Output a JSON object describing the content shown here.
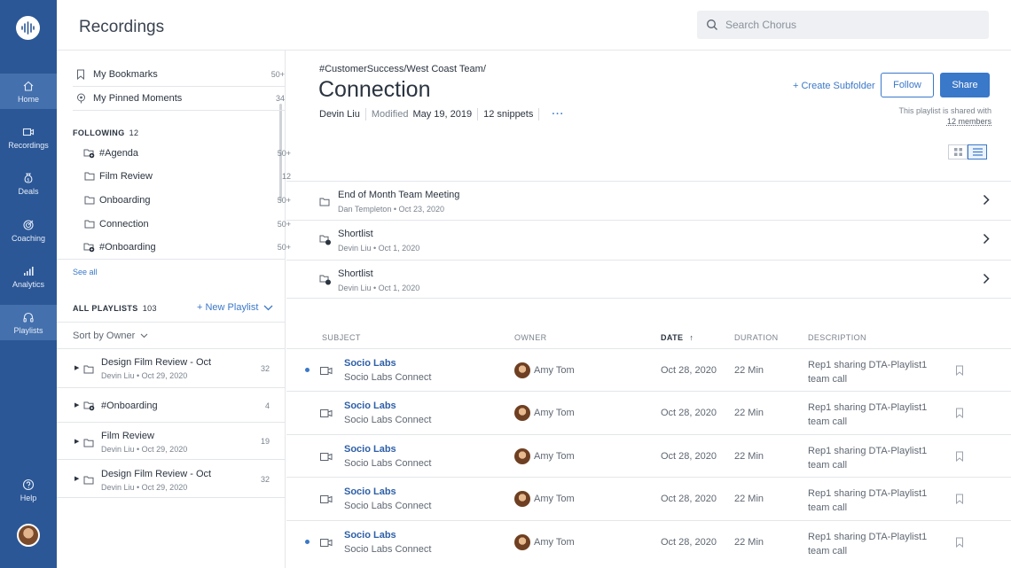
{
  "app": {
    "nav": [
      {
        "label": "Home",
        "icon": "home-icon",
        "active": true
      },
      {
        "label": "Recordings",
        "icon": "video-icon",
        "active": false
      },
      {
        "label": "Deals",
        "icon": "money-bag-icon",
        "active": false
      },
      {
        "label": "Coaching",
        "icon": "target-icon",
        "active": false
      },
      {
        "label": "Analytics",
        "icon": "bar-chart-icon",
        "active": false
      },
      {
        "label": "Playlists",
        "icon": "headphones-icon",
        "active": true
      },
      {
        "label": "Help",
        "icon": "help-icon",
        "active": false
      }
    ],
    "brand_color": "#2b5796",
    "accent_color": "#3a78c9"
  },
  "header": {
    "title": "Recordings",
    "search_placeholder": "Search Chorus"
  },
  "sidebar": {
    "top_items": [
      {
        "label": "My Bookmarks",
        "count": "50+",
        "icon": "bookmark-icon"
      },
      {
        "label": "My Pinned Moments",
        "count": "34",
        "icon": "pin-icon"
      }
    ],
    "following": {
      "heading": "FOLLOWING",
      "count": "12",
      "items": [
        {
          "label": "#Agenda",
          "count": "50+",
          "icon": "shared-folder-icon"
        },
        {
          "label": "Film Review",
          "count": "12",
          "icon": "folder-icon"
        },
        {
          "label": "Onboarding",
          "count": "50+",
          "icon": "folder-icon"
        },
        {
          "label": "Connection",
          "count": "50+",
          "icon": "folder-icon"
        },
        {
          "label": "#Onboarding",
          "count": "50+",
          "icon": "shared-folder-icon"
        }
      ],
      "see_all": "See all"
    },
    "all_playlists": {
      "heading": "ALL PLAYLISTS",
      "count": "103",
      "new_playlist": "+ New Playlist",
      "sort_label": "Sort by Owner",
      "items": [
        {
          "title": "Design Film Review - Oct",
          "sub": "Devin Liu • Oct 29, 2020",
          "count": "32",
          "icon": "folder-icon"
        },
        {
          "title": "#Onboarding",
          "sub": "",
          "count": "4",
          "icon": "shared-folder-icon"
        },
        {
          "title": "Film Review",
          "sub": "Devin Liu • Oct 29, 2020",
          "count": "19",
          "icon": "folder-icon"
        },
        {
          "title": "Design Film Review - Oct",
          "sub": "Devin Liu • Oct 29, 2020",
          "count": "32",
          "icon": "folder-icon"
        }
      ]
    }
  },
  "playlist": {
    "breadcrumb": "#CustomerSuccess/West Coast Team/",
    "title": "Connection",
    "owner": "Devin Liu",
    "modified_label": "Modified",
    "modified_date": "May 19, 2019",
    "snippets": "12 snippets",
    "more": "···",
    "create_subfolder": "+ Create Subfolder",
    "follow_label": "Follow",
    "share_label": "Share",
    "shared_text": "This playlist is shared with",
    "shared_members": "12 members",
    "subfolders": [
      {
        "title": "End of Month Team Meeting",
        "sub": "Dan Templeton • Oct 23, 2020",
        "icon": "folder-icon"
      },
      {
        "title": "Shortlist",
        "sub": "Devin Liu • Oct 1, 2020",
        "icon": "private-folder-icon"
      },
      {
        "title": "Shortlist",
        "sub": "Devin Liu • Oct 1, 2020",
        "icon": "private-folder-icon"
      }
    ],
    "table": {
      "headers": {
        "subject": "SUBJECT",
        "owner": "OWNER",
        "date": "DATE",
        "duration": "DURATION",
        "description": "DESCRIPTION"
      },
      "sort_arrow": "↑",
      "rows": [
        {
          "unread": true,
          "subject": "Socio Labs",
          "subtitle": "Socio Labs Connect",
          "owner": "Amy Tom",
          "date": "Oct 28, 2020",
          "duration": "22 Min",
          "description": "Rep1 sharing DTA-Playlist1 team call"
        },
        {
          "unread": false,
          "subject": "Socio Labs",
          "subtitle": "Socio Labs Connect",
          "owner": "Amy Tom",
          "date": "Oct 28, 2020",
          "duration": "22 Min",
          "description": "Rep1 sharing DTA-Playlist1 team call"
        },
        {
          "unread": false,
          "subject": "Socio Labs",
          "subtitle": "Socio Labs Connect",
          "owner": "Amy Tom",
          "date": "Oct 28, 2020",
          "duration": "22 Min",
          "description": "Rep1 sharing DTA-Playlist1 team call"
        },
        {
          "unread": false,
          "subject": "Socio Labs",
          "subtitle": "Socio Labs Connect",
          "owner": "Amy Tom",
          "date": "Oct 28, 2020",
          "duration": "22 Min",
          "description": "Rep1 sharing DTA-Playlist1 team call"
        },
        {
          "unread": true,
          "subject": "Socio Labs",
          "subtitle": "Socio Labs Connect",
          "owner": "Amy Tom",
          "date": "Oct 28, 2020",
          "duration": "22 Min",
          "description": "Rep1 sharing DTA-Playlist1 team call"
        }
      ]
    }
  }
}
